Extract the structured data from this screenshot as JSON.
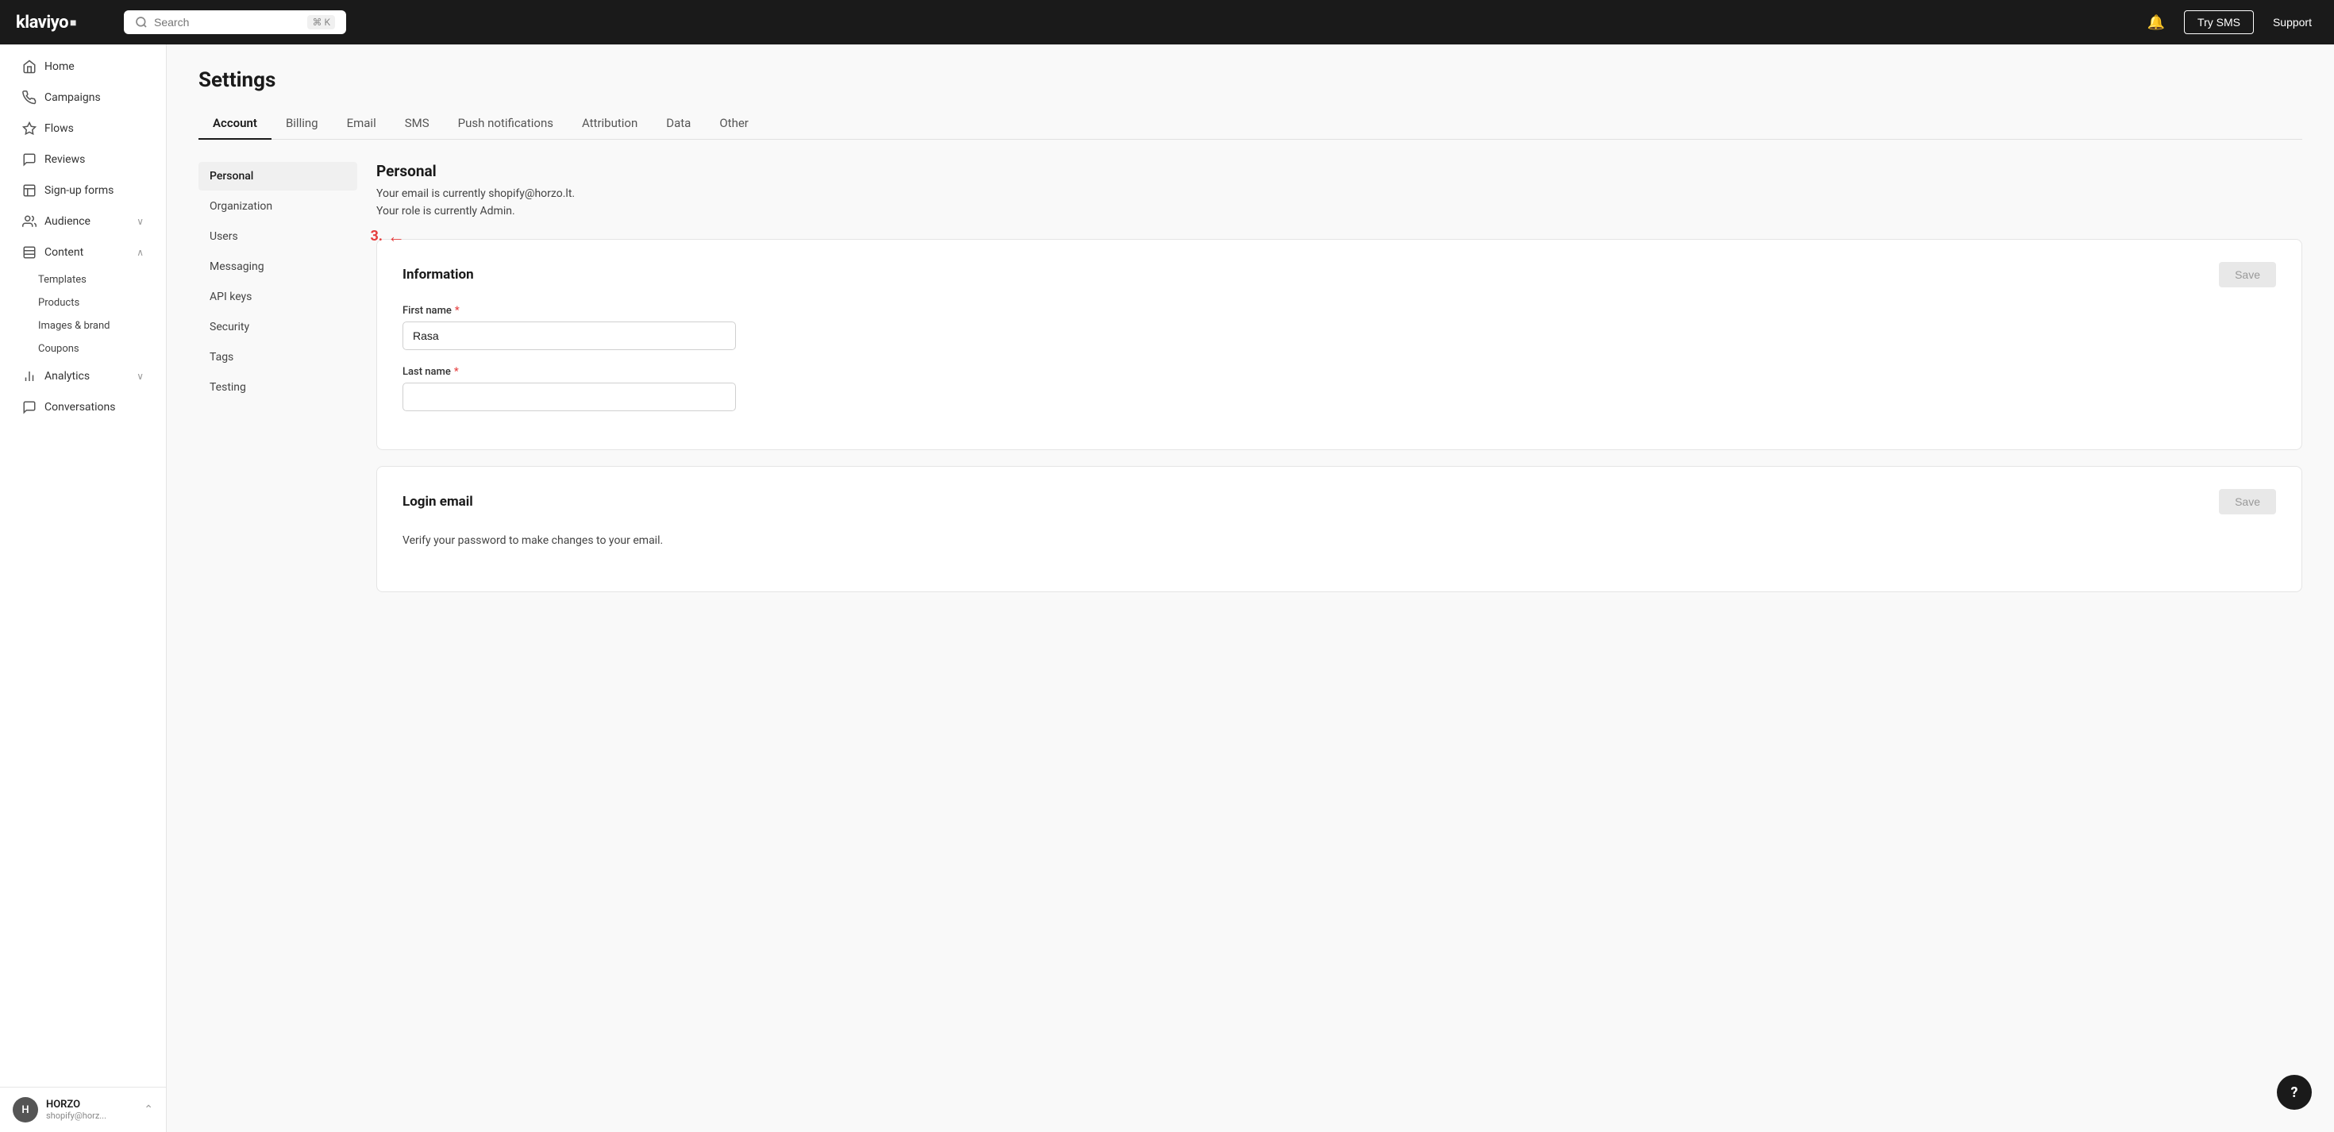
{
  "app": {
    "name": "klaviyo",
    "logo_mark": "■"
  },
  "topnav": {
    "search_placeholder": "Search",
    "search_shortcut": "⌘ K",
    "try_sms_label": "Try SMS",
    "support_label": "Support"
  },
  "sidebar": {
    "items": [
      {
        "id": "home",
        "label": "Home",
        "icon": "home"
      },
      {
        "id": "campaigns",
        "label": "Campaigns",
        "icon": "campaigns"
      },
      {
        "id": "flows",
        "label": "Flows",
        "icon": "flows"
      },
      {
        "id": "reviews",
        "label": "Reviews",
        "icon": "reviews"
      },
      {
        "id": "signup-forms",
        "label": "Sign-up forms",
        "icon": "forms"
      },
      {
        "id": "audience",
        "label": "Audience",
        "icon": "audience",
        "has_chevron": true,
        "chevron": "∨"
      },
      {
        "id": "content",
        "label": "Content",
        "icon": "content",
        "has_chevron": true,
        "chevron": "∧",
        "expanded": true
      }
    ],
    "content_sub": [
      {
        "id": "templates",
        "label": "Templates"
      },
      {
        "id": "products",
        "label": "Products"
      },
      {
        "id": "images-brand",
        "label": "Images & brand"
      },
      {
        "id": "coupons",
        "label": "Coupons"
      }
    ],
    "bottom_items": [
      {
        "id": "analytics",
        "label": "Analytics",
        "icon": "analytics",
        "has_chevron": true,
        "chevron": "∨"
      },
      {
        "id": "conversations",
        "label": "Conversations",
        "icon": "conversations"
      }
    ],
    "footer": {
      "avatar_letter": "H",
      "company": "HORZO",
      "email": "shopify@horz...",
      "chevron": "⌃"
    }
  },
  "page": {
    "title": "Settings"
  },
  "tabs": [
    {
      "id": "account",
      "label": "Account",
      "active": true
    },
    {
      "id": "billing",
      "label": "Billing"
    },
    {
      "id": "email",
      "label": "Email"
    },
    {
      "id": "sms",
      "label": "SMS"
    },
    {
      "id": "push",
      "label": "Push notifications"
    },
    {
      "id": "attribution",
      "label": "Attribution"
    },
    {
      "id": "data",
      "label": "Data"
    },
    {
      "id": "other",
      "label": "Other"
    }
  ],
  "settings_nav": [
    {
      "id": "personal",
      "label": "Personal",
      "active": true
    },
    {
      "id": "organization",
      "label": "Organization"
    },
    {
      "id": "users",
      "label": "Users",
      "annotated": true
    },
    {
      "id": "messaging",
      "label": "Messaging"
    },
    {
      "id": "api-keys",
      "label": "API keys"
    },
    {
      "id": "security",
      "label": "Security"
    },
    {
      "id": "tags",
      "label": "Tags"
    },
    {
      "id": "testing",
      "label": "Testing"
    }
  ],
  "personal_section": {
    "title": "Personal",
    "description_line1": "Your email is currently shopify@horzo.lt.",
    "description_line2": "Your role is currently Admin."
  },
  "information_card": {
    "title": "Information",
    "save_label": "Save",
    "first_name_label": "First name",
    "first_name_value": "Rasa",
    "last_name_label": "Last name",
    "last_name_value": "",
    "required_marker": "*"
  },
  "login_email_card": {
    "title": "Login email",
    "save_label": "Save",
    "description": "Verify your password to make changes to your email."
  },
  "annotation": {
    "number": "3.",
    "arrow": "←"
  },
  "help": {
    "label": "?"
  }
}
